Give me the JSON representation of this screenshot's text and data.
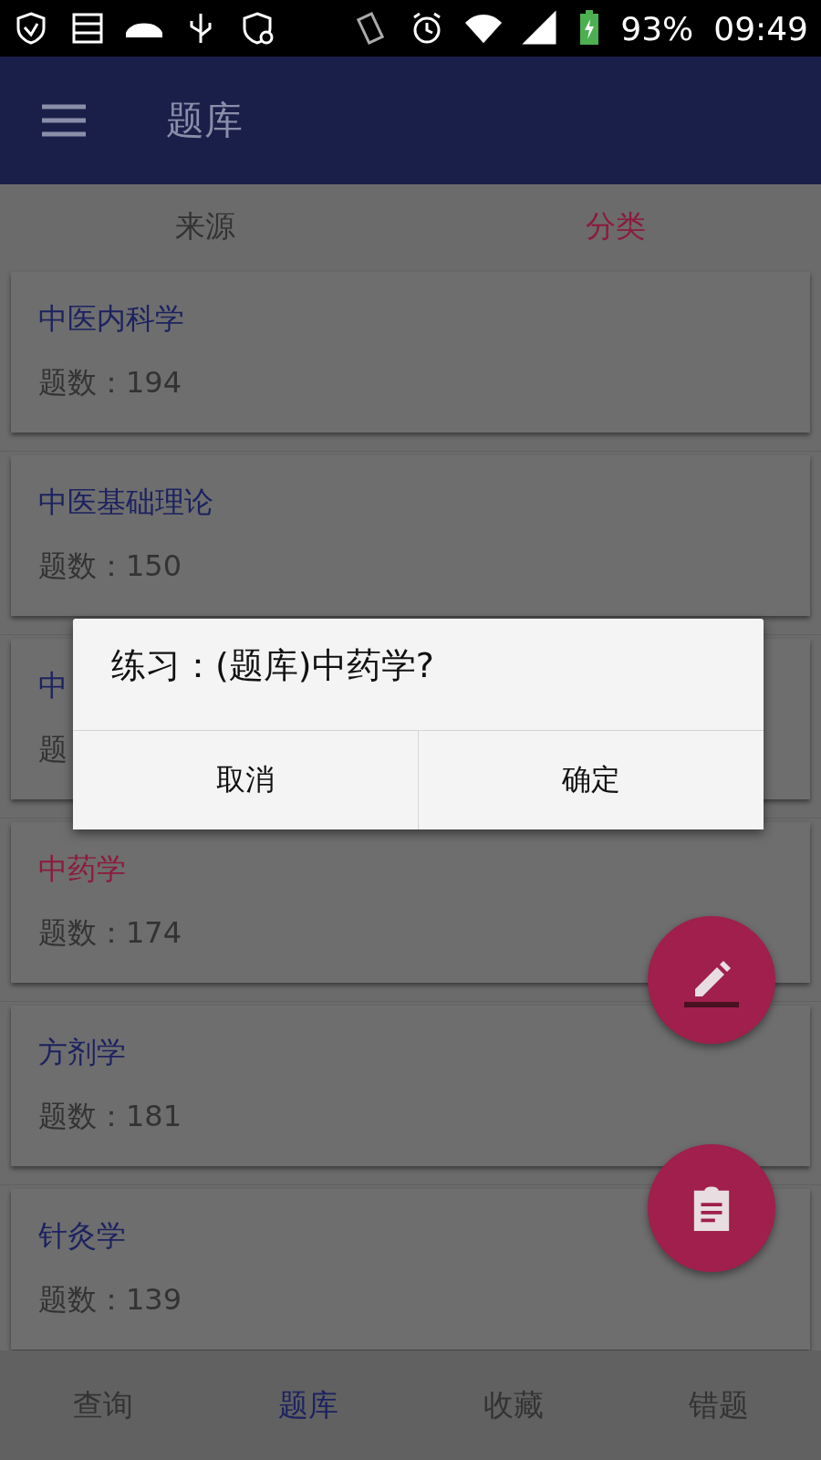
{
  "status_bar": {
    "battery": "93%",
    "time": "09:49"
  },
  "app_bar": {
    "title": "题库"
  },
  "tabs": [
    {
      "label": "来源",
      "selected": false
    },
    {
      "label": "分类",
      "selected": true
    }
  ],
  "cards": [
    {
      "title": "中医内科学",
      "count": "题数：194",
      "selected": false
    },
    {
      "title": "中医基础理论",
      "count": "题数：150",
      "selected": false
    },
    {
      "title": "中",
      "count": "题",
      "selected": false
    },
    {
      "title": "中药学",
      "count": "题数：174",
      "selected": true
    },
    {
      "title": "方剂学",
      "count": "题数：181",
      "selected": false
    },
    {
      "title": "针灸学",
      "count": "题数：139",
      "selected": false
    }
  ],
  "dialog": {
    "title": "练习：(题库)中药学?",
    "buttons": [
      "取消",
      "确定"
    ]
  },
  "bottom_nav": [
    {
      "label": "查询",
      "selected": false
    },
    {
      "label": "题库",
      "selected": true
    },
    {
      "label": "收藏",
      "selected": false
    },
    {
      "label": "错题",
      "selected": false
    }
  ]
}
